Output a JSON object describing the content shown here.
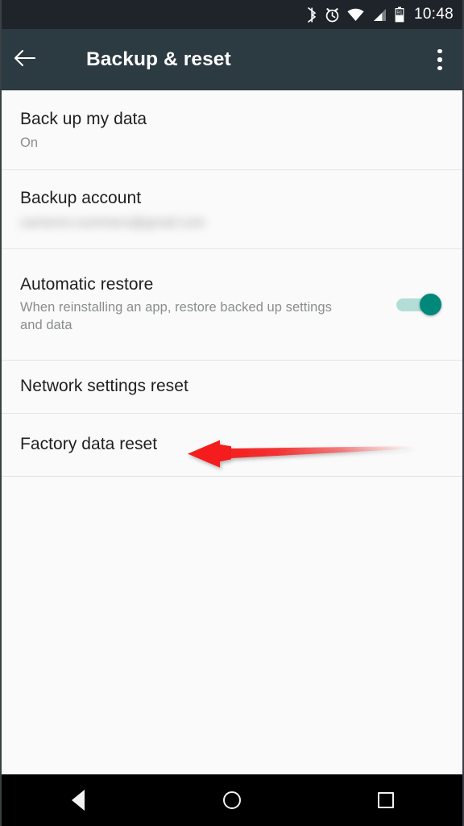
{
  "status_bar": {
    "time": "10:48",
    "battery_level": "91",
    "icons": [
      "bluetooth-icon",
      "alarm-icon",
      "wifi-icon",
      "cellular-signal-icon",
      "battery-icon"
    ],
    "background_color": "#1e2429"
  },
  "app_bar": {
    "title": "Backup & reset",
    "back_icon": "back-arrow-icon",
    "overflow_icon": "overflow-menu-icon",
    "background_color": "#2c3a42"
  },
  "settings": {
    "items": [
      {
        "title": "Back up my data",
        "subtitle": "On",
        "control": "none"
      },
      {
        "title": "Backup account",
        "subtitle": "cameron.summers@gmail.com",
        "subtitle_redacted": true,
        "control": "none"
      },
      {
        "title": "Automatic restore",
        "subtitle": "When reinstalling an app, restore backed up settings and data",
        "control": "switch",
        "switch_on": true
      },
      {
        "title": "Network settings reset",
        "subtitle": "",
        "control": "none"
      },
      {
        "title": "Factory data reset",
        "subtitle": "",
        "control": "none"
      }
    ]
  },
  "annotation": {
    "type": "arrow",
    "points_to": "Factory data reset",
    "color": "#f41c1c",
    "direction": "left"
  },
  "nav_bar": {
    "back_label": "Back",
    "home_label": "Home",
    "recents_label": "Recents",
    "background_color": "#000000"
  },
  "theme": {
    "page_background": "#fafafa",
    "divider_color": "#e4e4e4",
    "title_color": "#1f1f1f",
    "subtitle_color": "#8a8d8f",
    "switch_thumb_color": "#00897b",
    "switch_track_color": "#b4ddd8",
    "accent_red": "#f41c1c"
  }
}
